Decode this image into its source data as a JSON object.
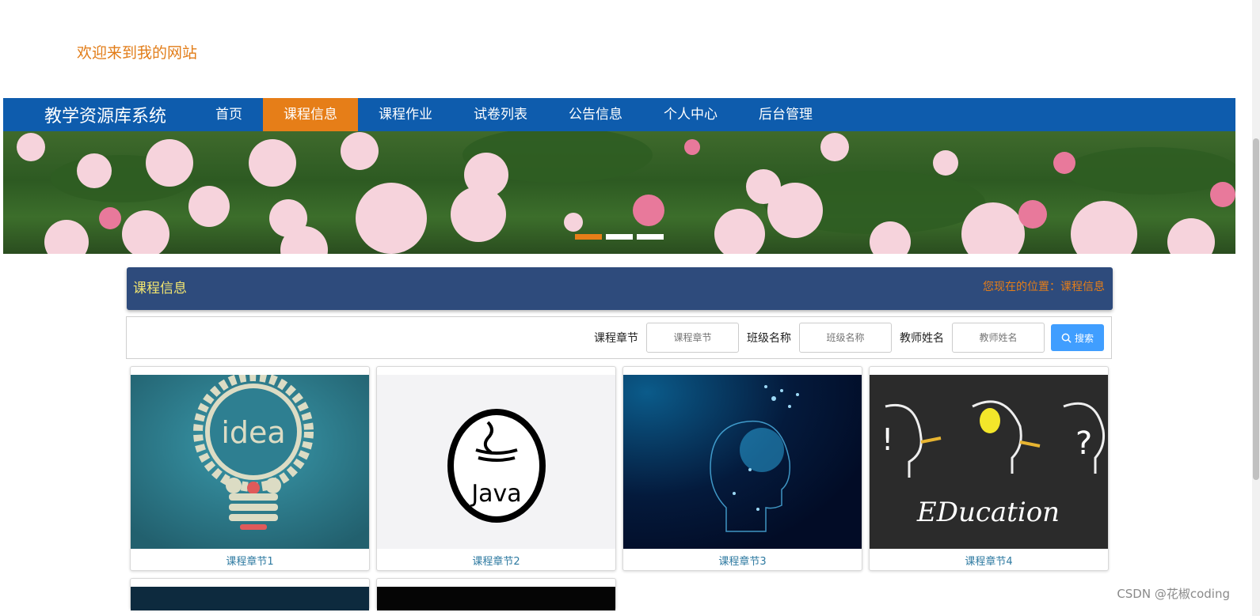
{
  "header": {
    "welcome": "欢迎来到我的网站"
  },
  "nav": {
    "brand": "教学资源库系统",
    "items": [
      "首页",
      "课程信息",
      "课程作业",
      "试卷列表",
      "公告信息",
      "个人中心",
      "后台管理"
    ],
    "active": "课程信息",
    "bg_color": "#0e5cad",
    "active_color": "#e67e18"
  },
  "banner": {
    "slide_count": 3,
    "active_index": 0
  },
  "section": {
    "title": "课程信息",
    "location_label": "您现在的位置：课程信息"
  },
  "search": {
    "fields": [
      {
        "label": "课程章节",
        "placeholder": "课程章节"
      },
      {
        "label": "班级名称",
        "placeholder": "班级名称"
      },
      {
        "label": "教师姓名",
        "placeholder": "教师姓名"
      }
    ],
    "button": "搜索"
  },
  "cards": [
    {
      "caption": "课程章节1",
      "image": "idea-lightbulb"
    },
    {
      "caption": "课程章节2",
      "image": "java-logo"
    },
    {
      "caption": "课程章节3",
      "image": "digital-head"
    },
    {
      "caption": "课程章节4",
      "image": "education-chalkboard"
    }
  ],
  "watermark": "CSDN @花椒coding"
}
